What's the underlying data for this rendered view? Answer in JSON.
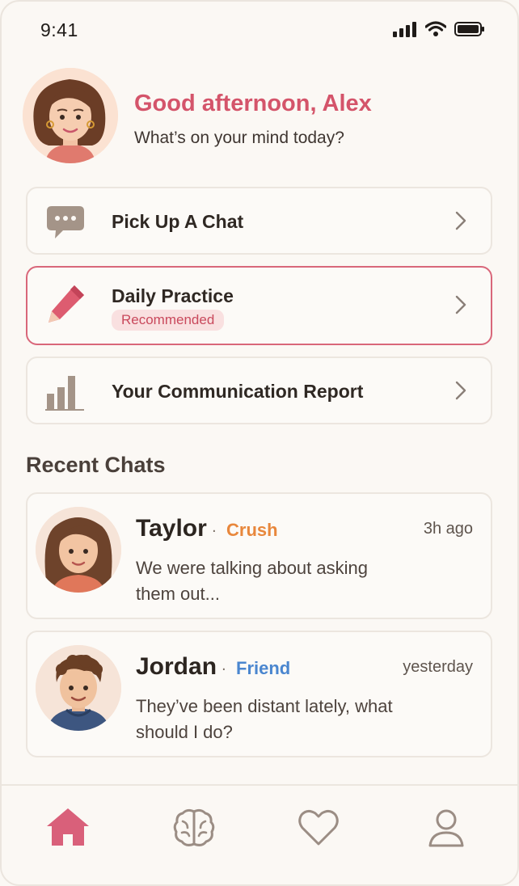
{
  "status_bar": {
    "time": "9:41"
  },
  "header": {
    "greeting": "Good afternoon, Alex",
    "subtitle": "What’s on your mind today?"
  },
  "menu": [
    {
      "label": "Pick Up A Chat",
      "icon": "chat-bubble-icon"
    },
    {
      "label": "Daily Practice",
      "badge": "Recommended",
      "icon": "pencil-icon"
    },
    {
      "label": "Your Communication Report",
      "icon": "bar-chart-icon"
    }
  ],
  "recent": {
    "title": "Recent Chats",
    "chats": [
      {
        "name": "Taylor",
        "tag": "Crush",
        "tag_color": "#e8873c",
        "time": "3h ago",
        "message": "We were talking about asking them out..."
      },
      {
        "name": "Jordan",
        "tag": "Friend",
        "tag_color": "#4a86cf",
        "time": "yesterday",
        "message": "They’ve been distant lately, what should I do?"
      }
    ]
  },
  "nav": [
    "home-icon",
    "brain-icon",
    "heart-icon",
    "profile-icon"
  ],
  "colors": {
    "accent": "#d4546a",
    "icon": "#a2948a",
    "active_nav": "#d9607a"
  }
}
